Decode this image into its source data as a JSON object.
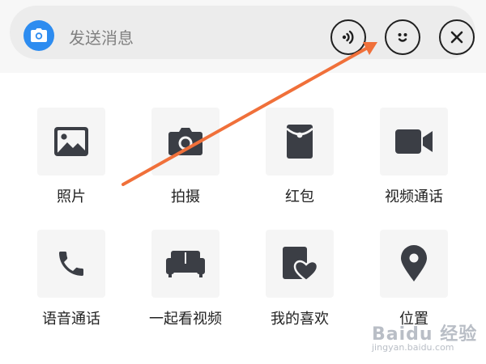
{
  "input_bar": {
    "placeholder": "发送消息",
    "camera_icon": "camera-icon",
    "voice_icon": "voice-icon",
    "emoji_icon": "emoji-icon",
    "close_icon": "close-icon"
  },
  "grid": [
    {
      "label": "照片",
      "icon": "image-icon"
    },
    {
      "label": "拍摄",
      "icon": "camera-icon"
    },
    {
      "label": "红包",
      "icon": "red-envelope-icon"
    },
    {
      "label": "视频通话",
      "icon": "video-camera-icon"
    },
    {
      "label": "语音通话",
      "icon": "phone-icon"
    },
    {
      "label": "一起看视频",
      "icon": "sofa-icon"
    },
    {
      "label": "我的喜欢",
      "icon": "favorite-icon"
    },
    {
      "label": "位置",
      "icon": "location-pin-icon"
    }
  ],
  "watermark": {
    "text": "Baidu 经验",
    "url": "jingyan.baidu.com"
  },
  "colors": {
    "accent_blue": "#2d8cf0",
    "arrow": "#f0703a",
    "icon_dark": "#3b3e45",
    "tile_bg": "#f5f5f5"
  }
}
